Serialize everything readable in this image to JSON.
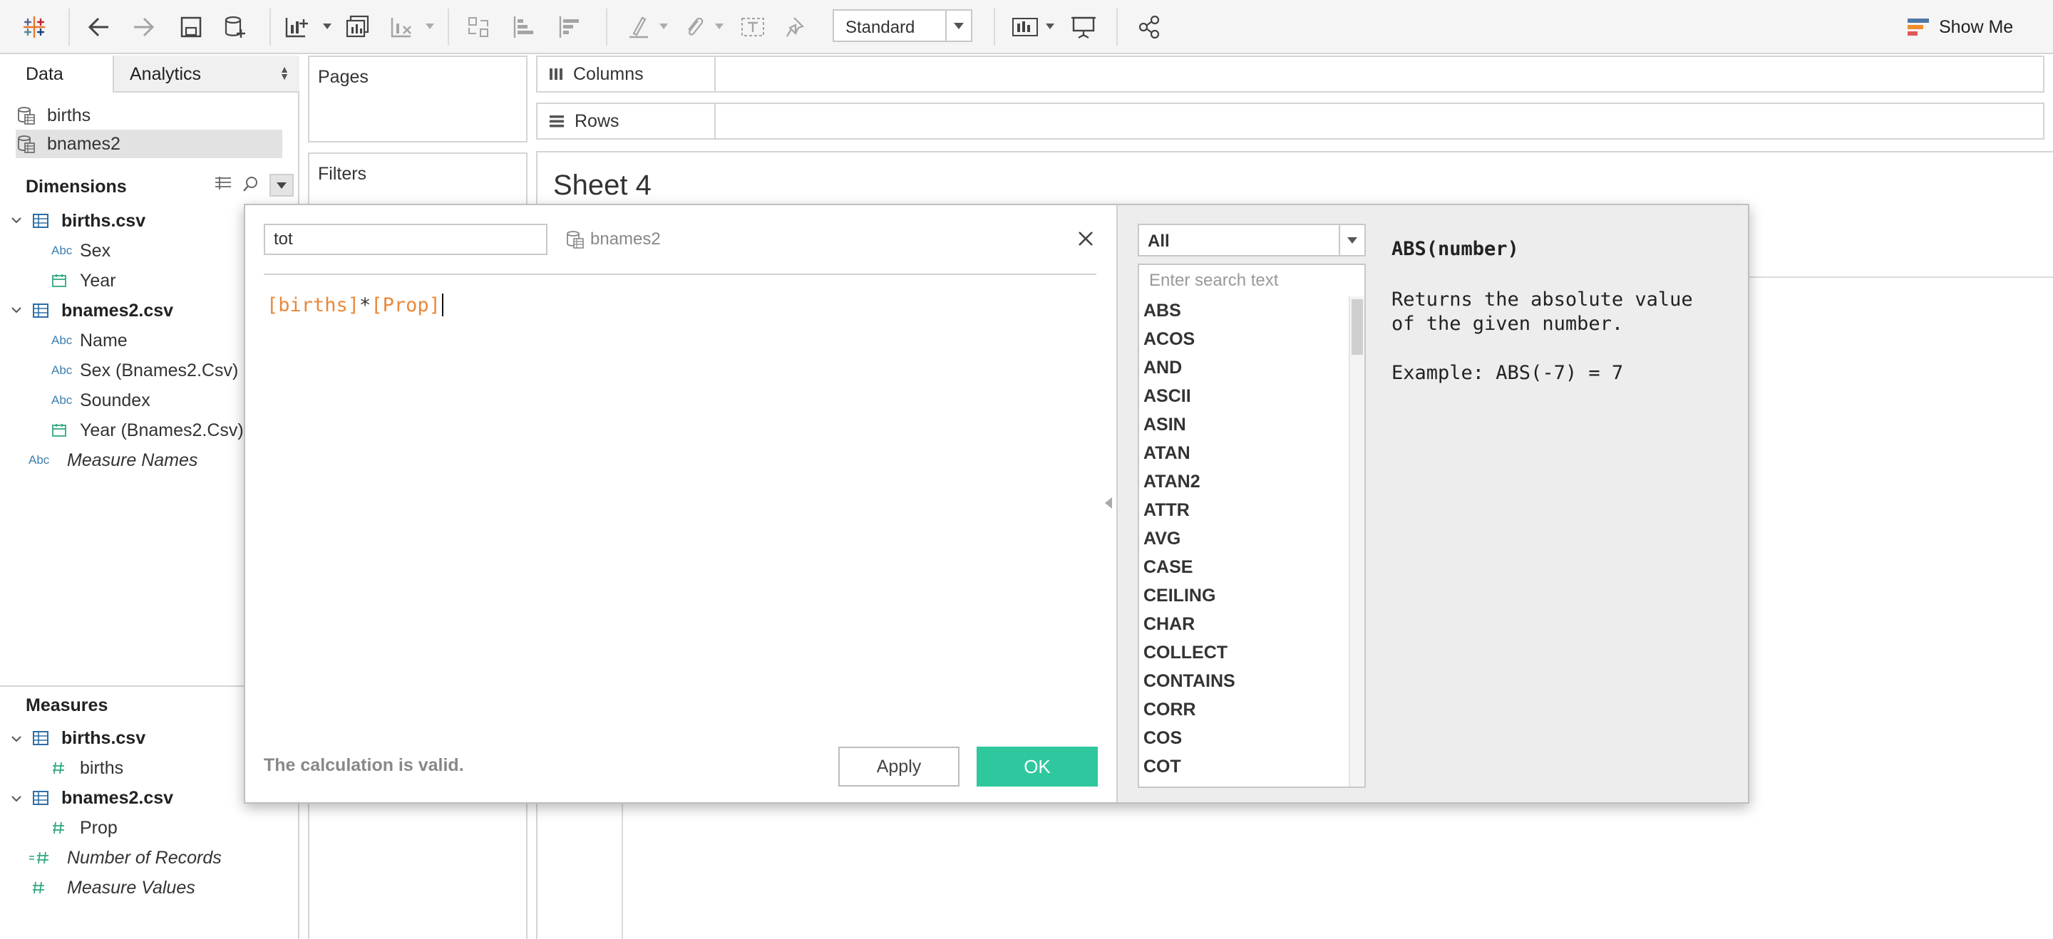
{
  "toolbar": {
    "view_mode": "Standard",
    "show_me_label": "Show Me",
    "show_me_colors": [
      "#4e79a7",
      "#f28e2b",
      "#e15759"
    ]
  },
  "left_pane": {
    "tabs": {
      "data": "Data",
      "analytics": "Analytics"
    },
    "data_sources": [
      {
        "label": "births",
        "selected": false
      },
      {
        "label": "bnames2",
        "selected": true
      }
    ],
    "dimensions": {
      "header": "Dimensions",
      "tables": [
        {
          "name": "births.csv",
          "fields": [
            {
              "label": "Sex",
              "type": "abc"
            },
            {
              "label": "Year",
              "type": "date"
            }
          ]
        },
        {
          "name": "bnames2.csv",
          "fields": [
            {
              "label": "Name",
              "type": "abc"
            },
            {
              "label": "Sex (Bnames2.Csv)",
              "type": "abc"
            },
            {
              "label": "Soundex",
              "type": "abc"
            },
            {
              "label": "Year (Bnames2.Csv)",
              "type": "date"
            }
          ]
        }
      ],
      "extra": "Measure Names"
    },
    "measures": {
      "header": "Measures",
      "tables": [
        {
          "name": "births.csv",
          "fields": [
            {
              "label": "births"
            }
          ]
        },
        {
          "name": "bnames2.csv",
          "fields": [
            {
              "label": "Prop"
            }
          ]
        }
      ],
      "extras": [
        "Number of Records",
        "Measure Values"
      ]
    }
  },
  "cards": {
    "pages": "Pages",
    "filters": "Filters"
  },
  "shelves": {
    "columns": "Columns",
    "rows": "Rows"
  },
  "sheet": {
    "title": "Sheet 4"
  },
  "calc_dialog": {
    "name": "tot",
    "data_source": "bnames2",
    "formula": {
      "field1": "[births]",
      "operator": "*",
      "field2": "[Prop]"
    },
    "status": "The calculation is valid.",
    "apply_label": "Apply",
    "ok_label": "OK",
    "function_filter": "All",
    "search_placeholder": "Enter search text",
    "functions": [
      "ABS",
      "ACOS",
      "AND",
      "ASCII",
      "ASIN",
      "ATAN",
      "ATAN2",
      "ATTR",
      "AVG",
      "CASE",
      "CEILING",
      "CHAR",
      "COLLECT",
      "CONTAINS",
      "CORR",
      "COS",
      "COT"
    ],
    "help": {
      "title": "ABS(number)",
      "description": "Returns the absolute value of the given number.",
      "example": "Example: ABS(-7) = 7"
    }
  },
  "colors": {
    "ok_button": "#2fc79e",
    "field_in_formula": "#e8883a",
    "dimension_icon": "#3c7fb1",
    "measure_icon": "#2fa87f"
  }
}
